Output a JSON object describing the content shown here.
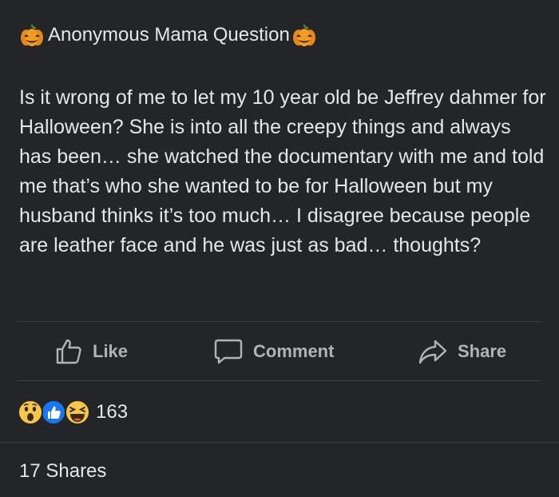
{
  "post": {
    "title": "Anonymous Mama Question",
    "title_icons": [
      "pumpkin-icon",
      "pumpkin-icon"
    ],
    "body": "Is it wrong of me to let my 10 year old be Jeffrey dahmer for Halloween? She is into all the creepy things and always has been… she watched the documentary with me and told me that’s who she wanted to be for Halloween but my husband thinks it’s too much… I disagree because people are leather face and he was just as bad… thoughts?"
  },
  "actions": {
    "like_label": "Like",
    "comment_label": "Comment",
    "share_label": "Share"
  },
  "reactions": {
    "icons": [
      "wow-reaction-icon",
      "like-reaction-icon",
      "haha-reaction-icon"
    ],
    "count": "163"
  },
  "shares": {
    "label": "17 Shares"
  },
  "colors": {
    "background": "#242526",
    "primary_text": "#e4e6eb",
    "secondary_text": "#b0b3b8",
    "divider": "#3e4042",
    "like_blue": "#1877f2",
    "reaction_yellow": "#f7c64a"
  }
}
